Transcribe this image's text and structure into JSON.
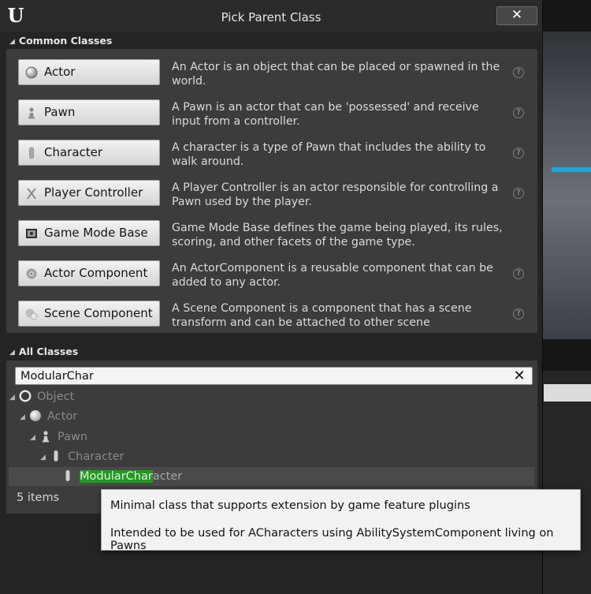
{
  "window": {
    "title": "Pick Parent Class",
    "close_label": "✕"
  },
  "common_classes": {
    "header": "Common Classes",
    "items": [
      {
        "label": "Actor",
        "icon": "sphere-icon",
        "description": "An Actor is an object that can be placed or spawned in the world."
      },
      {
        "label": "Pawn",
        "icon": "pawn-icon",
        "description": "A Pawn is an actor that can be 'possessed' and receive input from a controller."
      },
      {
        "label": "Character",
        "icon": "character-icon",
        "description": "A character is a type of Pawn that includes the ability to walk around."
      },
      {
        "label": "Player Controller",
        "icon": "controller-icon",
        "description": "A Player Controller is an actor responsible for controlling a Pawn used by the player."
      },
      {
        "label": "Game Mode Base",
        "icon": "game-mode-icon",
        "description": "Game Mode Base defines the game being played, its rules, scoring, and other facets of the game type."
      },
      {
        "label": "Actor Component",
        "icon": "component-icon",
        "description": "An ActorComponent is a reusable component that can be added to any actor."
      },
      {
        "label": "Scene Component",
        "icon": "scene-component-icon",
        "description": "A Scene Component is a component that has a scene transform and can be attached to other scene"
      }
    ]
  },
  "all_classes": {
    "header": "All Classes",
    "search_value": "ModularChar",
    "tree": [
      {
        "label": "Object",
        "icon": "object-icon"
      },
      {
        "label": "Actor",
        "icon": "sphere-icon"
      },
      {
        "label": "Pawn",
        "icon": "pawn-icon"
      },
      {
        "label": "Character",
        "icon": "character-icon"
      }
    ],
    "selected": {
      "match": "ModularChar",
      "rest": "acter",
      "icon": "character-icon"
    },
    "status": "5 items"
  },
  "tooltip": {
    "line1": "Minimal class that supports extension by game feature plugins",
    "line2": "Intended to be used for ACharacters using AbilitySystemComponent living on Pawns"
  },
  "colors": {
    "match_highlight": "#1e9c1e",
    "panel_bg": "#3c3c3c",
    "window_bg": "#242424"
  }
}
